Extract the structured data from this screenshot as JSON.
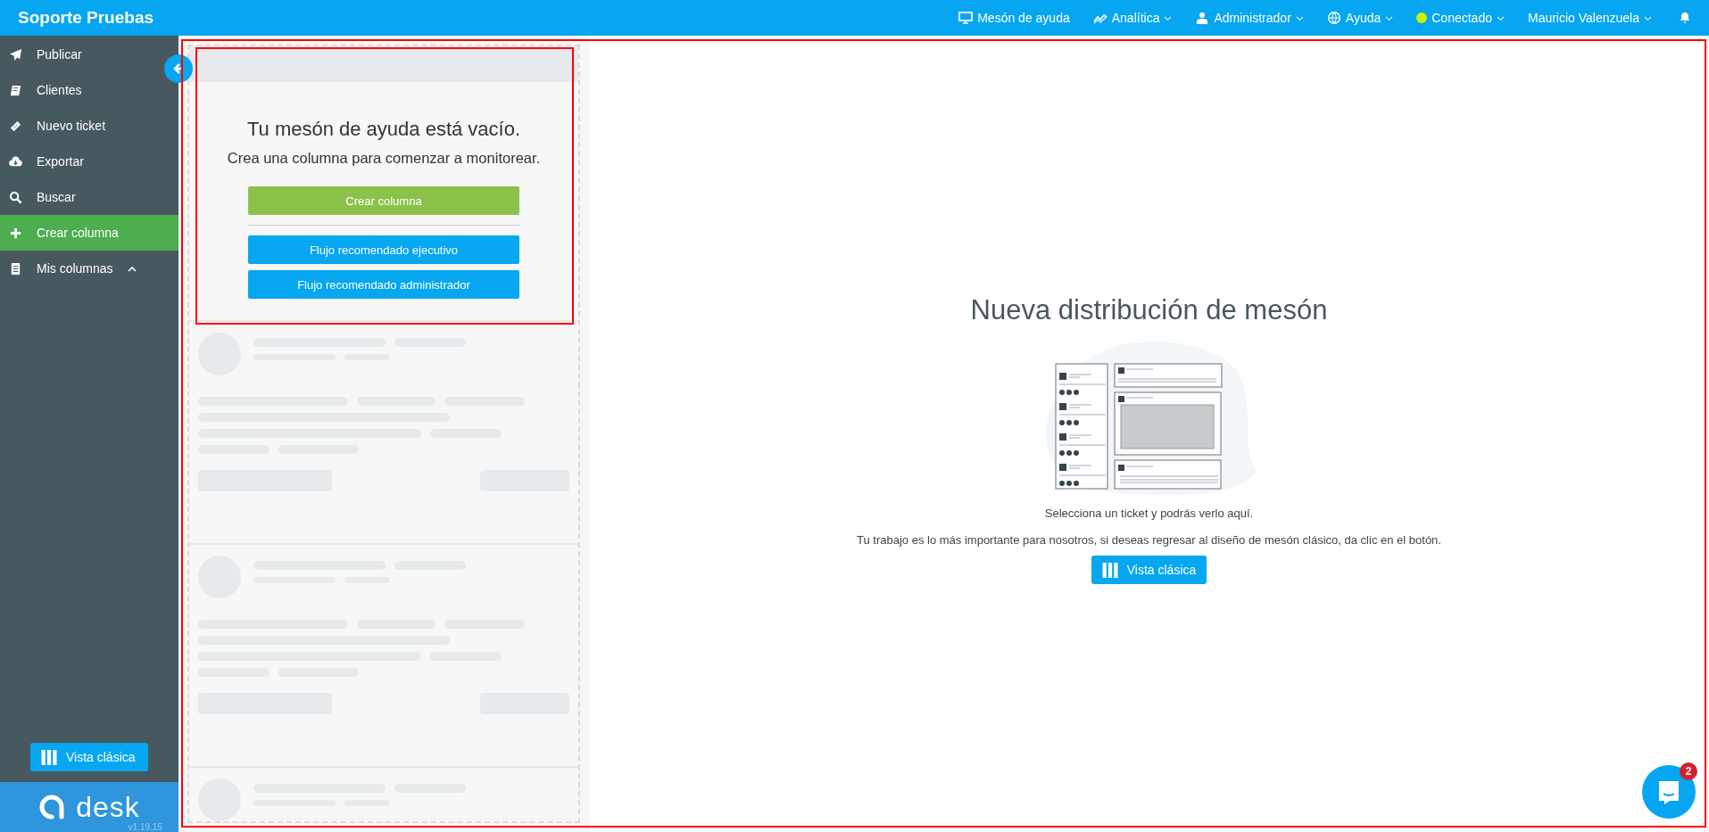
{
  "topbar": {
    "brand": "Soporte Pruebas",
    "nav": [
      {
        "label": "Mesón de ayuda",
        "dropdown": false
      },
      {
        "label": "Analítica",
        "dropdown": true
      },
      {
        "label": "Administrador",
        "dropdown": true
      },
      {
        "label": "Ayuda",
        "dropdown": true
      },
      {
        "label": "Conectado",
        "dropdown": true,
        "connected": true
      },
      {
        "label": "Mauricio Valenzuela",
        "dropdown": true
      }
    ]
  },
  "sidebar": {
    "items": [
      {
        "label": "Publicar",
        "selected": false
      },
      {
        "label": "Clientes",
        "selected": false
      },
      {
        "label": "Nuevo ticket",
        "selected": false
      },
      {
        "label": "Exportar",
        "selected": false
      },
      {
        "label": "Buscar",
        "selected": false
      },
      {
        "label": "Crear columna",
        "selected": true
      },
      {
        "label": "Mis columnas",
        "selected": false,
        "expanded": true
      }
    ],
    "classic_button": "Vista clásica",
    "logo_text": "desk",
    "version": "v1.19.15"
  },
  "empty_column": {
    "title": "Tu mesón de ayuda está vacío.",
    "subtitle": "Crea una columna para comenzar a monitorear.",
    "buttons": [
      {
        "label": "Crear columna",
        "kind": "primary"
      },
      {
        "label": "Flujo recomendado ejecutivo",
        "kind": "secondary"
      },
      {
        "label": "Flujo recomendado administrador",
        "kind": "secondary"
      }
    ]
  },
  "detail": {
    "title": "Nueva distribución de mesón",
    "hint": "Selecciona un ticket y podrás verlo aquí.",
    "message": "Tu trabajo es lo más importante para nosotros, si deseas regresar al diseño de mesón clásico, da clic en el botón.",
    "button": "Vista clásica"
  },
  "chat": {
    "badge": "2"
  }
}
